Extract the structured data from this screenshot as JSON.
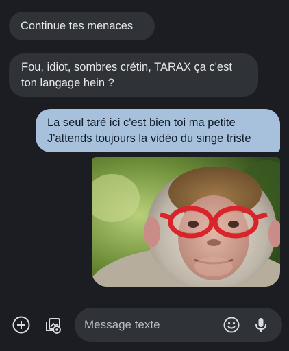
{
  "messages": [
    {
      "direction": "incoming",
      "lines": [
        "Continue tes menaces"
      ]
    },
    {
      "direction": "incoming",
      "lines": [
        "Fou, idiot, sombres crétin, TARAX  ça c'est",
        "ton langage hein ?"
      ]
    },
    {
      "direction": "outgoing",
      "lines": [
        "La seul taré ici c'est bien toi ma petite",
        "J'attends toujours la vidéo du singe triste"
      ]
    },
    {
      "direction": "outgoing",
      "type": "image",
      "icon": "monkey-with-red-glasses-photo"
    }
  ],
  "composer": {
    "placeholder": "Message texte",
    "icons": [
      "add-circle-icon",
      "gallery-icon",
      "emoji-icon",
      "microphone-icon"
    ]
  },
  "colors": {
    "background": "#1b1d22",
    "incoming_bubble": "#2f3237",
    "outgoing_bubble": "#a7c1dc",
    "glasses": "#d8242b"
  }
}
